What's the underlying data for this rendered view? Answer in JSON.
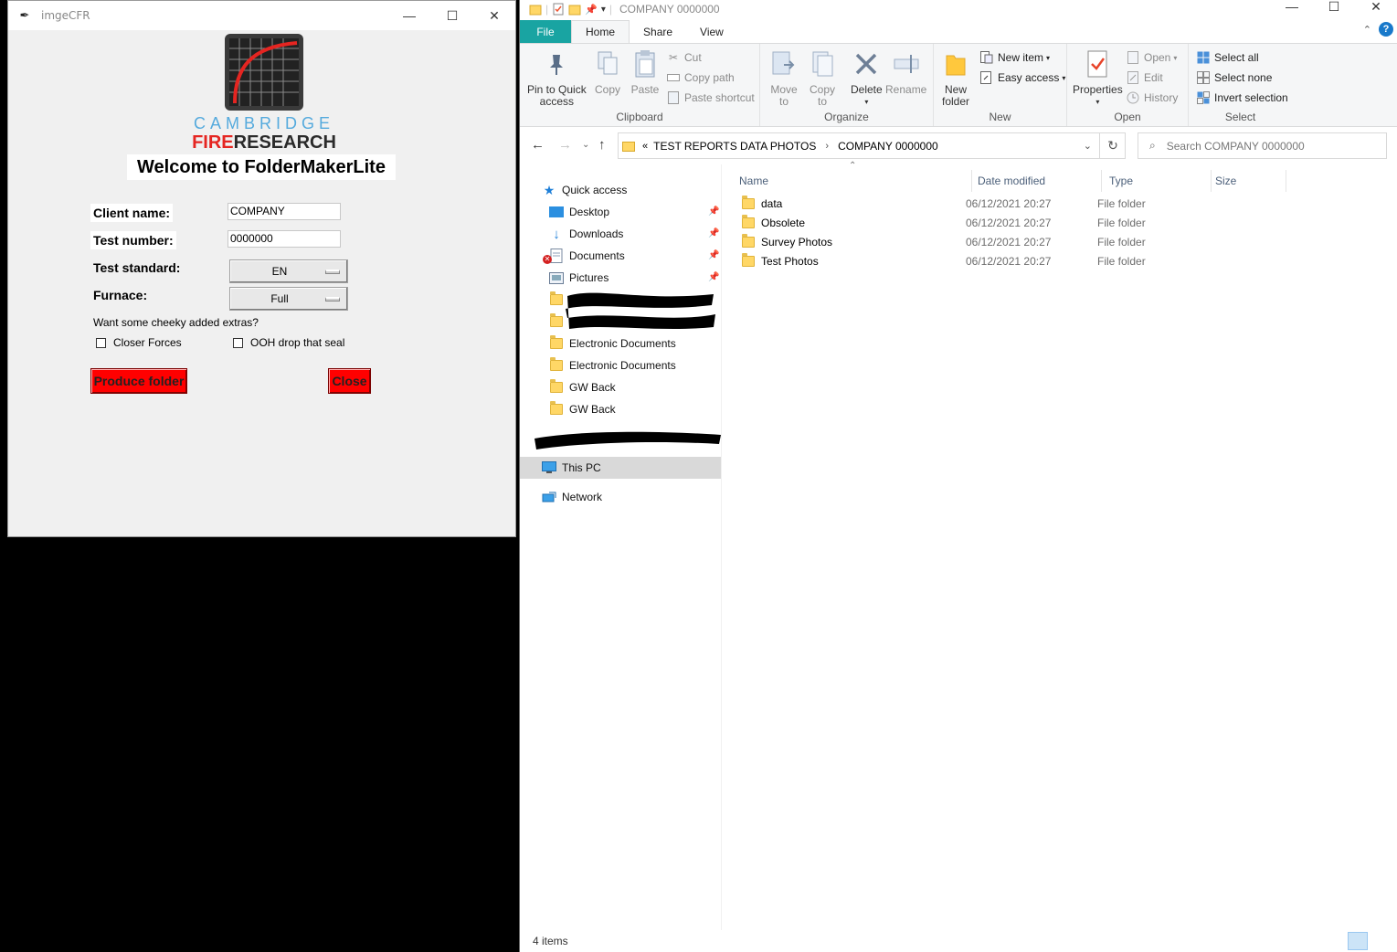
{
  "app": {
    "title": "imgeCFR",
    "logo": {
      "line1": "CAMBRIDGE",
      "line2_red": "FIRE",
      "line2_dark": "RESEARCH"
    },
    "welcome": "Welcome to FolderMakerLite",
    "client_label": "Client name:",
    "client_value": "COMPANY",
    "test_number_label": "Test number:",
    "test_number_value": "0000000",
    "standard_label": "Test standard:",
    "standard_value": "EN",
    "furnace_label": "Furnace:",
    "furnace_value": "Full",
    "extras_prompt": "Want some cheeky added extras?",
    "check1": "Closer Forces",
    "check2": "OOH drop that seal",
    "produce_btn": "Produce folder",
    "close_btn": "Close",
    "colors": {
      "button": "#ff0000",
      "logo_blue": "#55aadd",
      "logo_red": "#e52521"
    }
  },
  "explorer": {
    "title": "COMPANY 0000000",
    "tabs": {
      "file": "File",
      "home": "Home",
      "share": "Share",
      "view": "View"
    },
    "clipboard": {
      "pin_line1": "Pin to Quick",
      "pin_line2": "access",
      "copy": "Copy",
      "paste": "Paste",
      "cut": "Cut",
      "copy_path": "Copy path",
      "paste_shortcut": "Paste shortcut",
      "group": "Clipboard"
    },
    "organize": {
      "move_line1": "Move",
      "move_line2": "to",
      "copy_line1": "Copy",
      "copy_line2": "to",
      "delete": "Delete",
      "rename": "Rename",
      "group": "Organize"
    },
    "new": {
      "new_item": "New item",
      "easy_access": "Easy access",
      "new_folder_line1": "New",
      "new_folder_line2": "folder",
      "group": "New"
    },
    "open": {
      "properties": "Properties",
      "open": "Open",
      "edit": "Edit",
      "history": "History",
      "group": "Open"
    },
    "select": {
      "all": "Select all",
      "none": "Select none",
      "invert": "Invert selection",
      "group": "Select"
    },
    "address": {
      "crumb1": "TEST REPORTS DATA PHOTOS",
      "crumb2": "COMPANY 0000000"
    },
    "search_placeholder": "Search COMPANY 0000000",
    "nav": {
      "quick_access": "Quick access",
      "desktop": "Desktop",
      "downloads": "Downloads",
      "documents": "Documents",
      "pictures": "Pictures",
      "elec1": "Electronic Documents",
      "elec2": "Electronic Documents",
      "gw1": "GW Back",
      "gw2": "GW Back",
      "this_pc": "This PC",
      "network": "Network"
    },
    "columns": {
      "name": "Name",
      "date": "Date modified",
      "type": "Type",
      "size": "Size"
    },
    "files": [
      {
        "name": "data",
        "date": "06/12/2021 20:27",
        "type": "File folder"
      },
      {
        "name": "Obsolete",
        "date": "06/12/2021 20:27",
        "type": "File folder"
      },
      {
        "name": "Survey Photos",
        "date": "06/12/2021 20:27",
        "type": "File folder"
      },
      {
        "name": "Test Photos",
        "date": "06/12/2021 20:27",
        "type": "File folder"
      }
    ],
    "status": "4 items",
    "colors": {
      "file_tab": "#19a4a2",
      "select_bg": "#cce4f7",
      "nav_selected": "#d9d9d9"
    }
  }
}
